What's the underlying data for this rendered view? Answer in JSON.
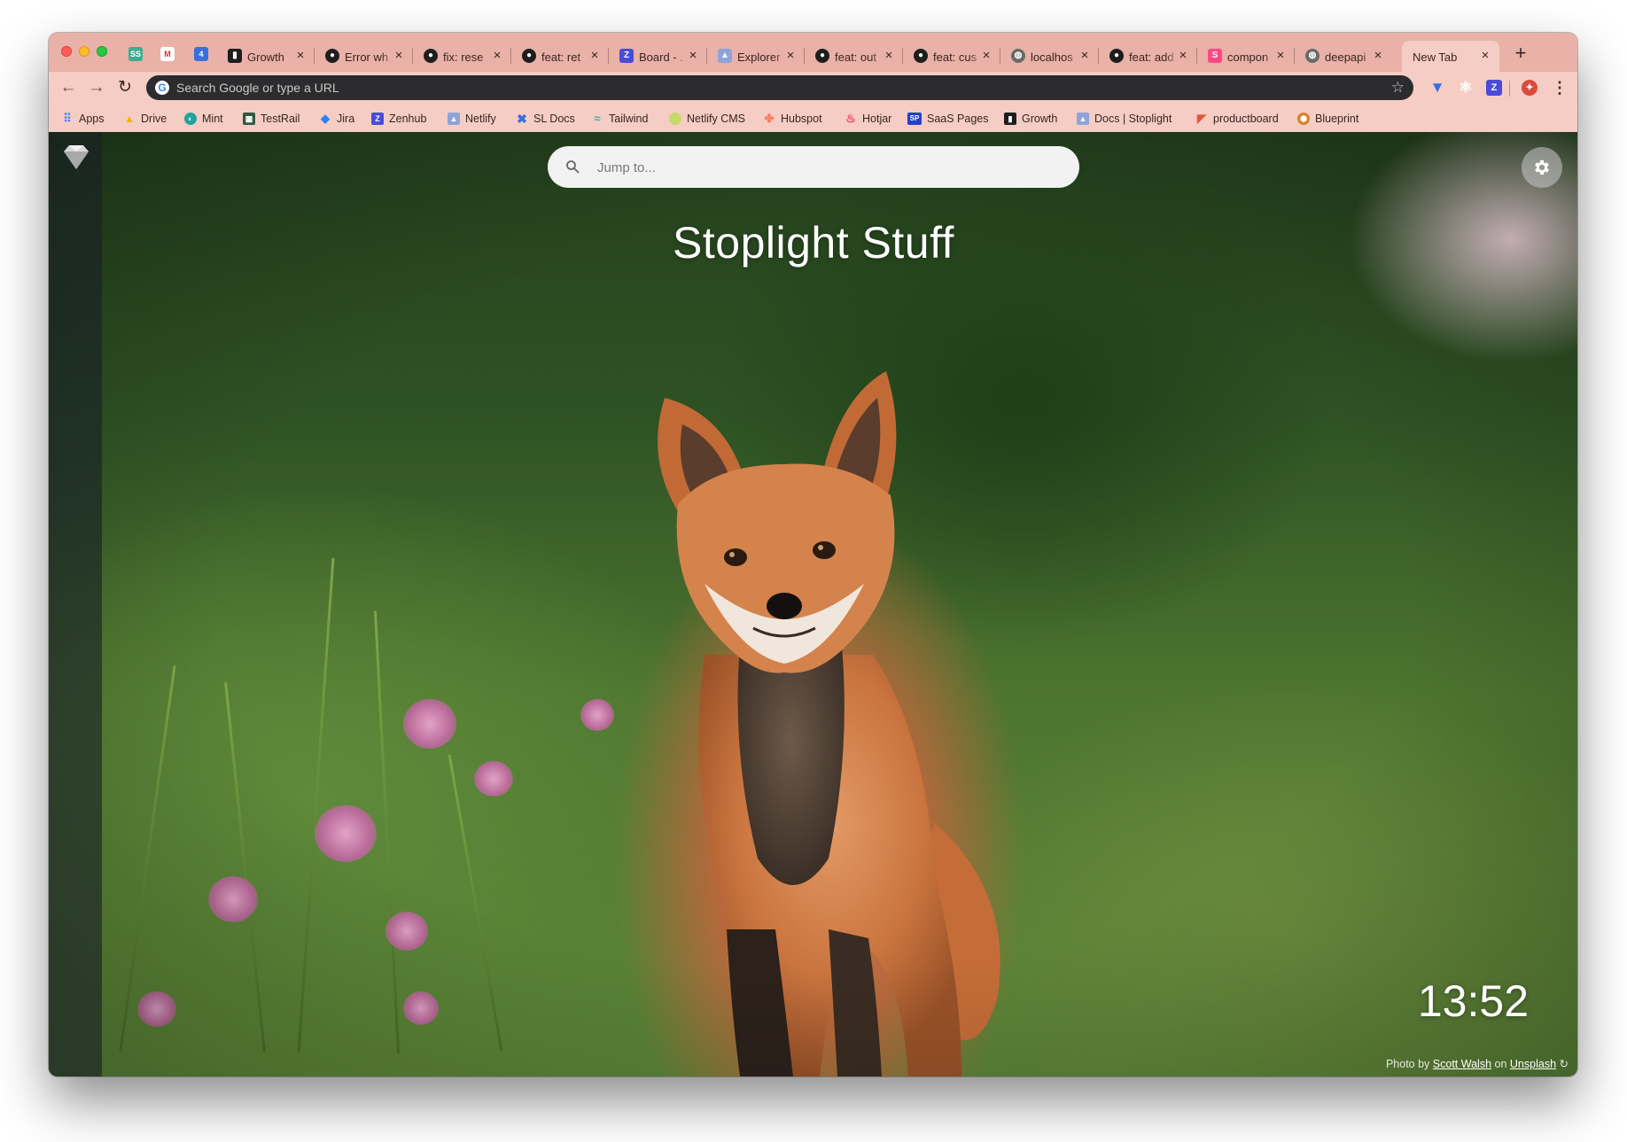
{
  "tabs": [
    {
      "title": "Growth",
      "favicon": "trello-icon",
      "color": "#1e1e1e"
    },
    {
      "title": "Error wh",
      "favicon": "github-icon",
      "color": "#1e1e1e"
    },
    {
      "title": "fix: rese",
      "favicon": "github-icon",
      "color": "#1e1e1e"
    },
    {
      "title": "feat: ret",
      "favicon": "github-icon",
      "color": "#1e1e1e"
    },
    {
      "title": "Board - .",
      "favicon": "zenhub-icon",
      "color": "#4a4bd6"
    },
    {
      "title": "Explorer",
      "favicon": "stoplight-icon",
      "color": "#8fa3d8"
    },
    {
      "title": "feat: out",
      "favicon": "github-icon",
      "color": "#1e1e1e"
    },
    {
      "title": "feat: cus",
      "favicon": "github-icon",
      "color": "#1e1e1e"
    },
    {
      "title": "localhos",
      "favicon": "globe-icon",
      "color": "#6a6a6a"
    },
    {
      "title": "feat: add",
      "favicon": "github-icon",
      "color": "#1e1e1e"
    },
    {
      "title": "compon",
      "favicon": "storybook-icon",
      "color": "#ff4785"
    },
    {
      "title": "deepapi",
      "favicon": "globe-icon",
      "color": "#6a6a6a"
    },
    {
      "title": "New Tab",
      "favicon": "",
      "color": "",
      "active": true
    }
  ],
  "toolbar": {
    "omnibox_placeholder": "Search Google or type a URL"
  },
  "bookmarks": [
    {
      "label": "Apps",
      "icon": "apps-grid-icon",
      "color": "#4285f4"
    },
    {
      "label": "Drive",
      "icon": "drive-icon",
      "color": "#f4b400"
    },
    {
      "label": "Mint",
      "icon": "mint-icon",
      "color": "#1fa39a"
    },
    {
      "label": "TestRail",
      "icon": "testrail-icon",
      "color": "#2e5a3c"
    },
    {
      "label": "Jira",
      "icon": "jira-icon",
      "color": "#2684ff"
    },
    {
      "label": "Zenhub",
      "icon": "zenhub-icon",
      "color": "#4a4bd6"
    },
    {
      "label": "Netlify",
      "icon": "stoplight-icon",
      "color": "#8fa3d8"
    },
    {
      "label": "SL Docs",
      "icon": "stoplight-x-icon",
      "color": "#3b6fd8"
    },
    {
      "label": "Tailwind",
      "icon": "tailwind-icon",
      "color": "#38b2ac"
    },
    {
      "label": "Netlify CMS",
      "icon": "netlify-cms-icon",
      "color": "#c7d96a"
    },
    {
      "label": "Hubspot",
      "icon": "hubspot-icon",
      "color": "#ff7a59"
    },
    {
      "label": "Hotjar",
      "icon": "hotjar-icon",
      "color": "#fd3a5c"
    },
    {
      "label": "SaaS Pages",
      "icon": "saaspages-icon",
      "color": "#2540c9"
    },
    {
      "label": "Growth",
      "icon": "trello-icon",
      "color": "#1e1e1e"
    },
    {
      "label": "Docs | Stoplight",
      "icon": "stoplight-icon",
      "color": "#8fa3d8"
    },
    {
      "label": "productboard",
      "icon": "productboard-icon",
      "color": "#e0573a"
    },
    {
      "label": "Blueprint",
      "icon": "blueprint-icon",
      "color": "#d9822b"
    }
  ],
  "newtab": {
    "search_placeholder": "Jump to...",
    "title": "Stoplight Stuff",
    "clock": "13:52",
    "credit": {
      "prefix": "Photo by",
      "author": "Scott Walsh",
      "middle": "on",
      "source": "Unsplash"
    }
  }
}
